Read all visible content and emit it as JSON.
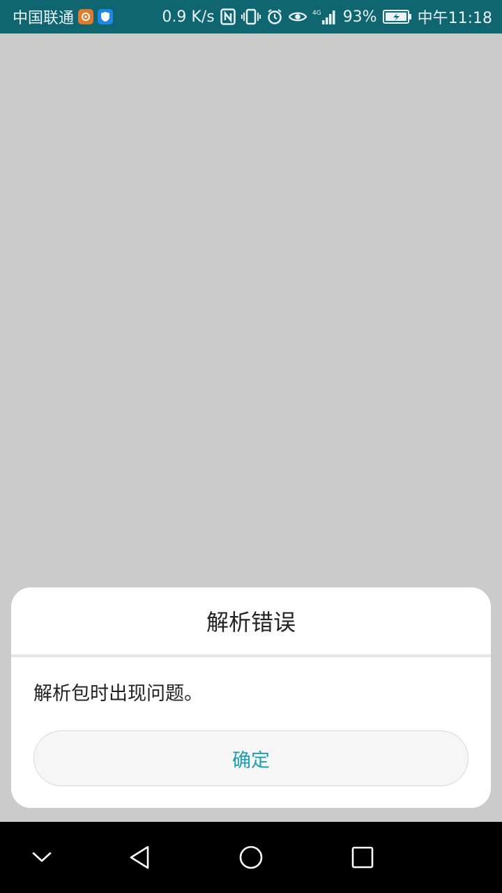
{
  "status_bar": {
    "carrier": "中国联通",
    "speed": "0.9 K/s",
    "network": "4G",
    "battery": "93%",
    "time": "中午11:18",
    "icons": [
      "uc-browser-icon",
      "shield-icon",
      "nfc-icon",
      "vibrate-icon",
      "alarm-icon",
      "eye-icon",
      "signal-icon",
      "battery-charging-icon"
    ]
  },
  "dialog": {
    "title": "解析错误",
    "message": "解析包时出现问题。",
    "confirm_label": "确定"
  },
  "nav_bar": {
    "icons": [
      "collapse-icon",
      "back-icon",
      "home-icon",
      "recents-icon"
    ]
  },
  "colors": {
    "status_bar": "#0f6570",
    "background": "#cbcbcb",
    "accent": "#1a9fb3"
  }
}
